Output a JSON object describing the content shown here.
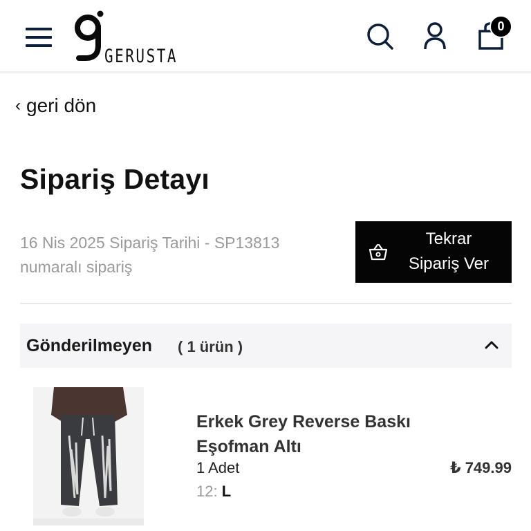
{
  "header": {
    "brand": "GERUSTA",
    "icons": [
      "menu-icon",
      "search-icon",
      "user-icon",
      "shopping-bag-icon"
    ],
    "cart_count": "0"
  },
  "nav": {
    "back_label": "geri dön"
  },
  "page": {
    "title": "Sipariş Detayı",
    "order_meta": "16 Nis 2025 Sipariş Tarihi - SP13813 numaralı sipariş"
  },
  "reorder": {
    "line1": "Tekrar",
    "line2": "Sipariş Ver"
  },
  "section": {
    "title": "Gönderilmeyen",
    "count": "( 1 ürün )",
    "expanded": true
  },
  "product": {
    "name": "Erkek Grey Reverse Baskı Eşofman Altı",
    "quantity": "1 Adet",
    "size_label": "12:",
    "size_value": "L",
    "price": "₺ 749.99"
  },
  "colors": {
    "navy": "#0c1e3a",
    "black": "#050505",
    "muted": "#9a9a9a",
    "section_bg": "#f5f5f7"
  }
}
